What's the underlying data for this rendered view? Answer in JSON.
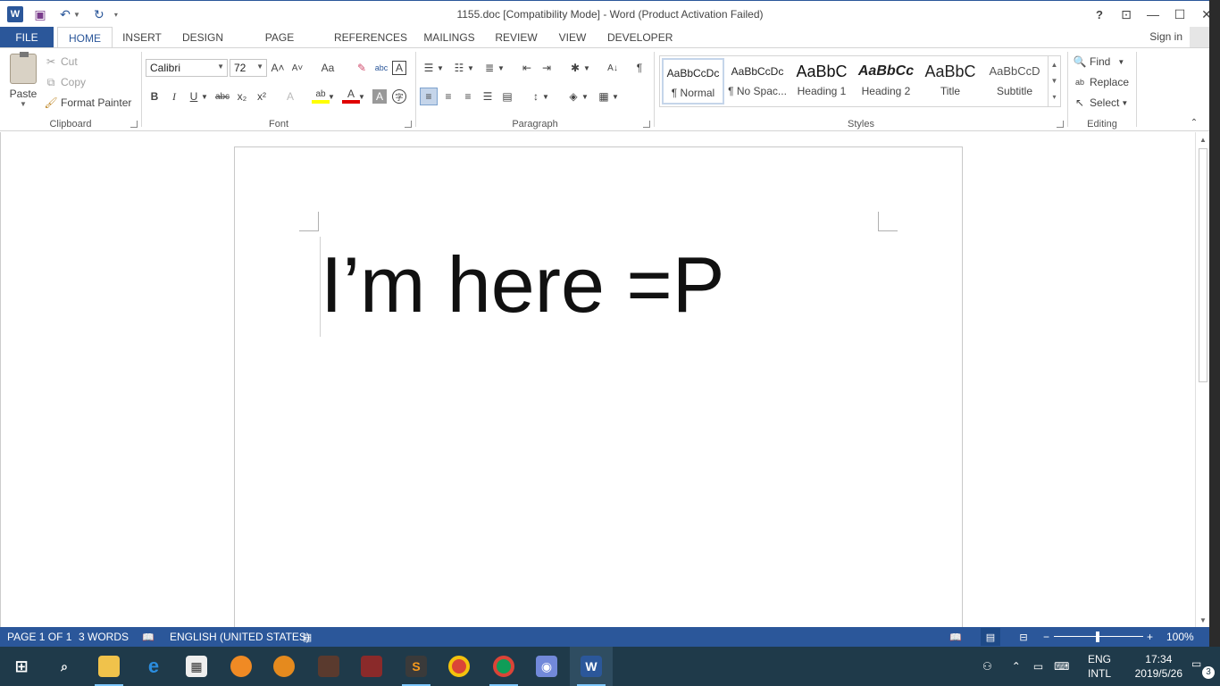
{
  "titlebar": {
    "title": "1155.doc [Compatibility Mode] - Word (Product Activation Failed)",
    "help": "?",
    "minimize": "—",
    "maximize": "☐",
    "close": "✕",
    "ribbon_display": "⊡"
  },
  "qat": {
    "word_logo": "W",
    "save": "💾",
    "undo": "↶",
    "redo": "↻",
    "customize": "▾"
  },
  "tabs": [
    "FILE",
    "HOME",
    "INSERT",
    "DESIGN",
    "PAGE LAYOUT",
    "REFERENCES",
    "MAILINGS",
    "REVIEW",
    "VIEW",
    "DEVELOPER"
  ],
  "active_tab": "HOME",
  "signin": "Sign in",
  "clipboard": {
    "paste": "Paste",
    "cut": "Cut",
    "copy": "Copy",
    "format_painter": "Format Painter",
    "label": "Clipboard"
  },
  "font": {
    "name": "Calibri",
    "size": "72",
    "label": "Font",
    "grow": "A˄",
    "shrink": "A˅",
    "change_case": "Aa",
    "bold": "B",
    "italic": "I",
    "underline": "U",
    "strike": "abc",
    "subscript": "x₂",
    "superscript": "x²",
    "text_effects": "A",
    "highlight": "ab",
    "font_color": "A",
    "shading": "A",
    "enclose": "字"
  },
  "paragraph": {
    "label": "Paragraph",
    "pilcrow": "¶"
  },
  "styles": {
    "label": "Styles",
    "items": [
      {
        "preview": "AaBbCcDc",
        "name": "¶ Normal"
      },
      {
        "preview": "AaBbCcDc",
        "name": "¶ No Spac..."
      },
      {
        "preview": "AaBbC",
        "name": "Heading 1"
      },
      {
        "preview": "AaBbCc",
        "name": "Heading 2"
      },
      {
        "preview": "AaBbC",
        "name": "Title"
      },
      {
        "preview": "AaBbCcD",
        "name": "Subtitle"
      }
    ]
  },
  "editing": {
    "label": "Editing",
    "find": "Find",
    "replace": "Replace",
    "select": "Select"
  },
  "document": {
    "text": "I’m here =P"
  },
  "status": {
    "page": "PAGE 1 OF 1",
    "words": "3 WORDS",
    "language": "ENGLISH (UNITED STATES)",
    "zoom": "100%",
    "zoom_minus": "−",
    "zoom_plus": "+",
    "zoom_level": 1.0
  },
  "taskbar": {
    "lang_top": "ENG",
    "lang_bottom": "INTL",
    "time": "17:34",
    "date": "2019/5/26",
    "notifications": "3",
    "apps": [
      "start",
      "search",
      "file-explorer",
      "edge",
      "store",
      "fish-app",
      "monkey-app",
      "avatar-app-1",
      "avatar-app-2",
      "sublime-text",
      "chrome",
      "chrome-canary",
      "discord",
      "word"
    ]
  },
  "colors": {
    "accent": "#2b579a",
    "taskbar": "#1f3a4a",
    "highlight": "#ffff00",
    "font_red": "#e00000"
  }
}
